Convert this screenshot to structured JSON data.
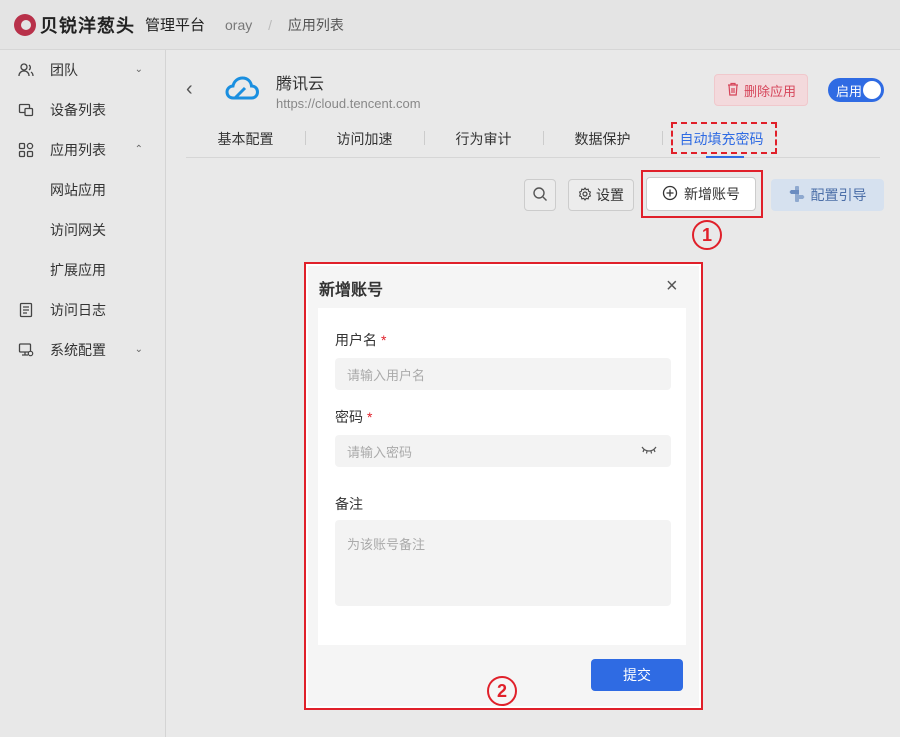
{
  "header": {
    "logo_text": "贝锐洋葱头",
    "platform": "管理平台",
    "breadcrumb": [
      "oray",
      "应用列表"
    ],
    "breadcrumb_sep": "/"
  },
  "sidebar": {
    "items": [
      {
        "label": "团队",
        "icon": "team-icon",
        "expandable": true
      },
      {
        "label": "设备列表",
        "icon": "devices-icon"
      },
      {
        "label": "应用列表",
        "icon": "apps-icon",
        "expandable": true,
        "expanded": true
      },
      {
        "label": "网站应用",
        "sub": true
      },
      {
        "label": "访问网关",
        "sub": true
      },
      {
        "label": "扩展应用",
        "sub": true
      },
      {
        "label": "访问日志",
        "icon": "log-icon"
      },
      {
        "label": "系统配置",
        "icon": "system-config-icon",
        "expandable": true
      }
    ]
  },
  "app": {
    "name": "腾讯云",
    "url": "https://cloud.tencent.com",
    "delete_label": "删除应用",
    "toggle_label": "启用",
    "toggle_on": true
  },
  "tabs": [
    "基本配置",
    "访问加速",
    "行为审计",
    "数据保护",
    "自动填充密码"
  ],
  "active_tab_index": 4,
  "toolbar": {
    "settings_label": "设置",
    "add_label": "新增账号",
    "guide_label": "配置引导"
  },
  "markers": {
    "one": "1",
    "two": "2"
  },
  "modal": {
    "title": "新增账号",
    "username_label": "用户名",
    "username_placeholder": "请输入用户名",
    "password_label": "密码",
    "password_placeholder": "请输入密码",
    "required_mark": "*",
    "note_label": "备注",
    "note_placeholder": "为该账号备注",
    "submit_label": "提交"
  },
  "colors": {
    "accent": "#2f6be3",
    "danger": "#e0202a",
    "brand": "#b8314a"
  }
}
